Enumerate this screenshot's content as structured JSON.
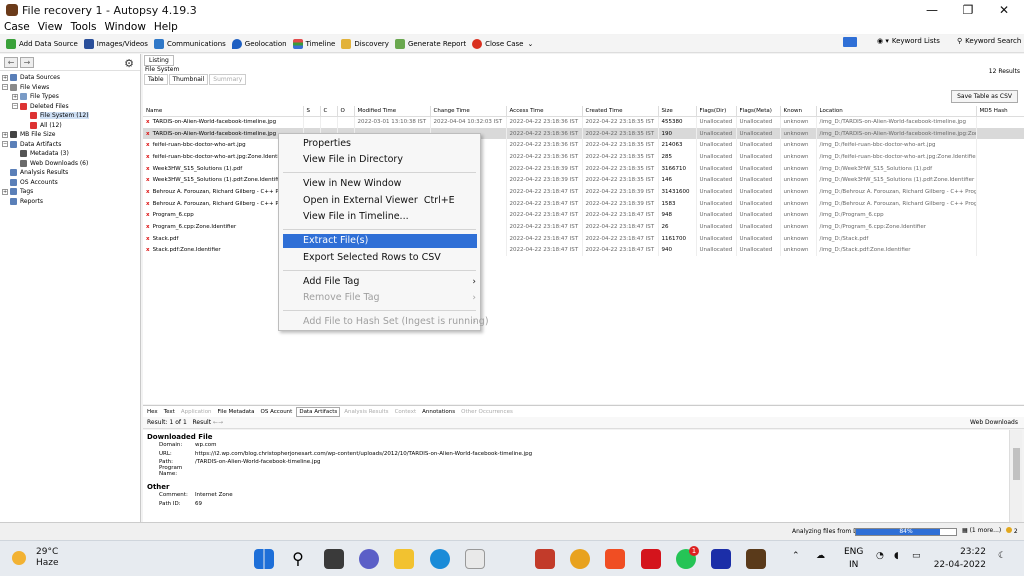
{
  "window": {
    "title": "File recovery 1 - Autopsy 4.19.3",
    "minimize": "—",
    "maximize": "❐",
    "close": "✕"
  },
  "menu": [
    "Case",
    "View",
    "Tools",
    "Window",
    "Help"
  ],
  "toolbar": {
    "add_data_source": "Add Data Source",
    "images_videos": "Images/Videos",
    "communications": "Communications",
    "geolocation": "Geolocation",
    "timeline": "Timeline",
    "discovery": "Discovery",
    "generate_report": "Generate Report",
    "close_case": "Close Case",
    "keyword_lists": "Keyword Lists",
    "keyword_search": "Keyword Search"
  },
  "tree": [
    {
      "label": "Data Sources",
      "indent": 0,
      "exp": "+",
      "color": "#5a7fb8"
    },
    {
      "label": "File Views",
      "indent": 0,
      "exp": "−",
      "color": "#8a8a8a"
    },
    {
      "label": "File Types",
      "indent": 1,
      "exp": "+",
      "color": "#7a9bc6"
    },
    {
      "label": "Deleted Files",
      "indent": 1,
      "exp": "−",
      "color": "#d33"
    },
    {
      "label": "File System (12)",
      "indent": 2,
      "exp": "",
      "color": "#d33",
      "selected": true
    },
    {
      "label": "All (12)",
      "indent": 2,
      "exp": "",
      "color": "#d33"
    },
    {
      "label": "MB File Size",
      "indent": 0,
      "exp": "+",
      "color": "#444"
    },
    {
      "label": "Data Artifacts",
      "indent": 0,
      "exp": "−",
      "color": "#5a7fb8"
    },
    {
      "label": "Metadata (3)",
      "indent": 1,
      "exp": "",
      "color": "#555"
    },
    {
      "label": "Web Downloads (6)",
      "indent": 1,
      "exp": "",
      "color": "#6a6a6a"
    },
    {
      "label": "Analysis Results",
      "indent": 0,
      "exp": "",
      "color": "#5a7fb8"
    },
    {
      "label": "OS Accounts",
      "indent": 0,
      "exp": "",
      "color": "#5a7fb8"
    },
    {
      "label": "Tags",
      "indent": 0,
      "exp": "+",
      "color": "#5a7fb8"
    },
    {
      "label": "Reports",
      "indent": 0,
      "exp": "",
      "color": "#5a7fb8"
    }
  ],
  "listing": {
    "tab": "Listing",
    "path": "File System",
    "results": "12 Results",
    "subtabs": [
      "Table",
      "Thumbnail",
      "Summary"
    ],
    "save_button": "Save Table as CSV",
    "columns": [
      "Name",
      "S",
      "C",
      "O",
      "Modified Time",
      "Change Time",
      "Access Time",
      "Created Time",
      "Size",
      "Flags(Dir)",
      "Flags(Meta)",
      "Known",
      "Location",
      "MD5 Hash"
    ],
    "rows": [
      [
        "TARDIS-on-Alien-World-facebook-timeline.jpg",
        "",
        "",
        "",
        "2022-03-01 13:10:38 IST",
        "2022-04-04 10:32:03 IST",
        "2022-04-22 23:18:36 IST",
        "2022-04-22 23:18:35 IST",
        "455380",
        "Unallocated",
        "Unallocated",
        "unknown",
        "/img_D:/TARDIS-on-Alien-World-facebook-timeline.jpg",
        ""
      ],
      [
        "TARDIS-on-Alien-World-facebook-timeline.jpg",
        "",
        "",
        "",
        "",
        "",
        "2022-04-22 23:18:36 IST",
        "2022-04-22 23:18:35 IST",
        "190",
        "Unallocated",
        "Unallocated",
        "unknown",
        "/img_D:/TARDIS-on-Alien-World-facebook-timeline.jpg:Zon...",
        ""
      ],
      [
        "feifei-ruan-bbc-doctor-who-art.jpg",
        "",
        "",
        "",
        "",
        "",
        "2022-04-22 23:18:36 IST",
        "2022-04-22 23:18:35 IST",
        "214063",
        "Unallocated",
        "Unallocated",
        "unknown",
        "/img_D:/feifei-ruan-bbc-doctor-who-art.jpg",
        ""
      ],
      [
        "feifei-ruan-bbc-doctor-who-art.jpg:Zone.Identifier",
        "",
        "",
        "",
        "",
        "",
        "2022-04-22 23:18:36 IST",
        "2022-04-22 23:18:35 IST",
        "285",
        "Unallocated",
        "Unallocated",
        "unknown",
        "/img_D:/feifei-ruan-bbc-doctor-who-art.jpg:Zone.Identifier",
        ""
      ],
      [
        "Week3HW_S15_Solutions (1).pdf",
        "",
        "",
        "",
        "",
        "",
        "2022-04-22 23:18:39 IST",
        "2022-04-22 23:18:35 IST",
        "3166710",
        "Unallocated",
        "Unallocated",
        "unknown",
        "/img_D:/Week3HW_S15_Solutions (1).pdf",
        ""
      ],
      [
        "Week3HW_S15_Solutions (1).pdf:Zone.Identifier",
        "",
        "",
        "",
        "",
        "",
        "2022-04-22 23:18:39 IST",
        "2022-04-22 23:18:35 IST",
        "146",
        "Unallocated",
        "Unallocated",
        "unknown",
        "/img_D:/Week3HW_S15_Solutions (1).pdf:Zone.Identifier",
        ""
      ],
      [
        "Behrouz A. Forouzan, Richard Gilberg - C++ Programming",
        "",
        "",
        "",
        "",
        "",
        "2022-04-22 23:18:47 IST",
        "2022-04-22 23:18:39 IST",
        "31431600",
        "Unallocated",
        "Unallocated",
        "unknown",
        "/img_D:/Behrouz A. Forouzan, Richard Gilberg - C++ Progr...",
        ""
      ],
      [
        "Behrouz A. Forouzan, Richard Gilberg - C++ Programming",
        "",
        "",
        "",
        "",
        "",
        "2022-04-22 23:18:47 IST",
        "2022-04-22 23:18:39 IST",
        "1583",
        "Unallocated",
        "Unallocated",
        "unknown",
        "/img_D:/Behrouz A. Forouzan, Richard Gilberg - C++ Progr...",
        ""
      ],
      [
        "Program_6.cpp",
        "",
        "",
        "",
        "",
        "",
        "2022-04-22 23:18:47 IST",
        "2022-04-22 23:18:47 IST",
        "948",
        "Unallocated",
        "Unallocated",
        "unknown",
        "/img_D:/Program_6.cpp",
        ""
      ],
      [
        "Program_6.cpp:Zone.Identifier",
        "",
        "",
        "",
        "",
        "",
        "2022-04-22 23:18:47 IST",
        "2022-04-22 23:18:47 IST",
        "26",
        "Unallocated",
        "Unallocated",
        "unknown",
        "/img_D:/Program_6.cpp:Zone.Identifier",
        ""
      ],
      [
        "Stack.pdf",
        "",
        "",
        "",
        "",
        "",
        "2022-04-22 23:18:47 IST",
        "2022-04-22 23:18:47 IST",
        "1161700",
        "Unallocated",
        "Unallocated",
        "unknown",
        "/img_D:/Stack.pdf",
        ""
      ],
      [
        "Stack.pdf:Zone.Identifier",
        "",
        "",
        "",
        "",
        "",
        "2022-04-22 23:18:47 IST",
        "2022-04-22 23:18:47 IST",
        "940",
        "Unallocated",
        "Unallocated",
        "unknown",
        "/img_D:/Stack.pdf:Zone.Identifier",
        ""
      ]
    ],
    "selected_row": 1
  },
  "context_menu": {
    "properties": "Properties",
    "view_in_directory": "View File in Directory",
    "view_new_window": "View in New Window",
    "open_external": "Open in External Viewer",
    "open_external_shortcut": "Ctrl+E",
    "view_timeline": "View File in Timeline...",
    "extract": "Extract File(s)",
    "export_csv": "Export Selected Rows to CSV",
    "add_tag": "Add File Tag",
    "remove_tag": "Remove File Tag",
    "add_hash": "Add File to Hash Set (Ingest is running)"
  },
  "bottom_tabs": [
    {
      "label": "Hex",
      "state": "normal"
    },
    {
      "label": "Text",
      "state": "normal"
    },
    {
      "label": "Application",
      "state": "disabled"
    },
    {
      "label": "File Metadata",
      "state": "normal"
    },
    {
      "label": "OS Account",
      "state": "normal"
    },
    {
      "label": "Data Artifacts",
      "state": "active"
    },
    {
      "label": "Analysis Results",
      "state": "disabled"
    },
    {
      "label": "Context",
      "state": "disabled"
    },
    {
      "label": "Annotations",
      "state": "normal"
    },
    {
      "label": "Other Occurrences",
      "state": "disabled"
    }
  ],
  "result_bar": {
    "result_label": "Result:",
    "index": "1",
    "of": "of",
    "total": "1",
    "result_nav": "Result",
    "type": "Web Downloads"
  },
  "artifact": {
    "section1": "Downloaded File",
    "fields1": [
      {
        "k": "Domain:",
        "v": "wp.com"
      },
      {
        "k": "URL:",
        "v": "https://i2.wp.com/blog.christopherjonesart.com/wp-content/uploads/2012/10/TARDIS-on-Alien-World-facebook-timeline.jpg"
      },
      {
        "k": "Path:",
        "v": "/TARDIS-on-Alien-World-facebook-timeline.jpg"
      },
      {
        "k": "Program Name:",
        "v": ""
      }
    ],
    "section2": "Other",
    "fields2": [
      {
        "k": "Comment:",
        "v": "Internet Zone"
      },
      {
        "k": "Path ID:",
        "v": "69"
      }
    ]
  },
  "status": {
    "analyzing": "Analyzing files from D:",
    "percent_text": "84%",
    "progress": 0.84,
    "more": "(1 more...)",
    "notif_count": "2"
  },
  "taskbar": {
    "temp": "29°C",
    "weather": "Haze",
    "lang1": "ENG",
    "lang2": "IN",
    "time": "23:22",
    "date": "22-04-2022",
    "whatsapp_badge": "1"
  }
}
